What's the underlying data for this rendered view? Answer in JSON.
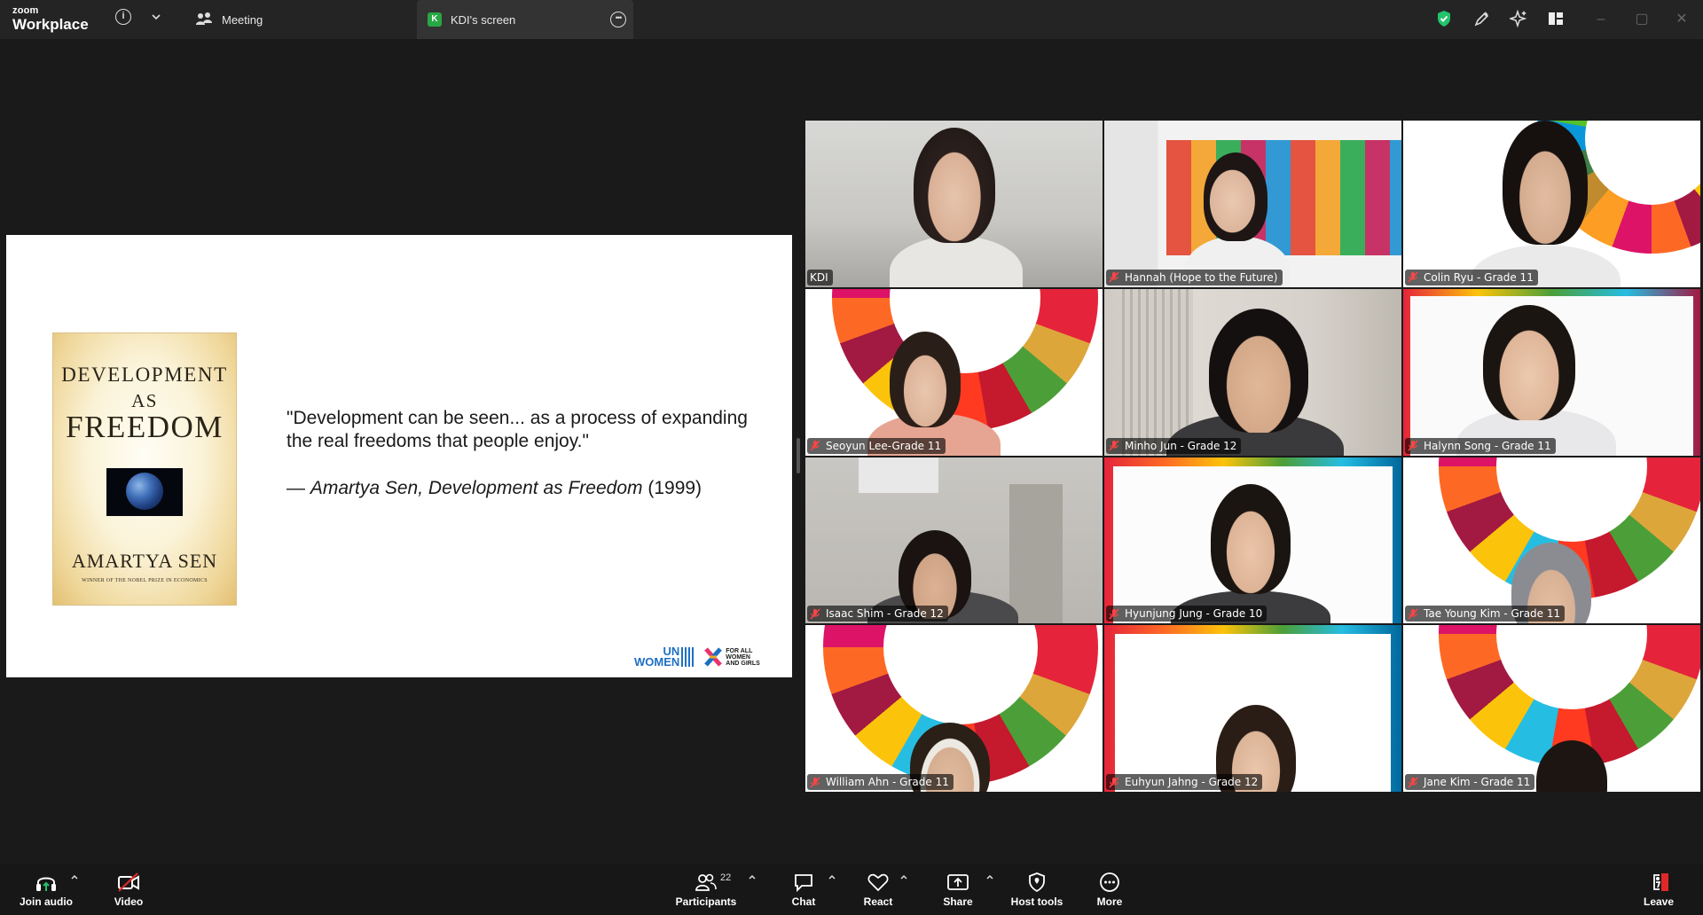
{
  "app": {
    "logo_top": "zoom",
    "logo_bottom": "Workplace"
  },
  "tabs": [
    {
      "label": "Meeting"
    },
    {
      "label": "KDI's screen",
      "badge": "K"
    }
  ],
  "slide": {
    "book": {
      "title_line1": "DEVELOPMENT",
      "title_line2": "AS",
      "title_line3": "FREEDOM",
      "author": "AMARTYA SEN",
      "tagline": "WINNER OF THE NOBEL PRIZE IN ECONOMICS"
    },
    "quote": "\"Development can be seen... as a process of expanding the real freedoms that people enjoy.\"",
    "attribution_prefix": "— ",
    "attribution_italic": "Amartya Sen, Development as Freedom",
    "attribution_year": " (1999)",
    "logo_un_1": "UN",
    "logo_un_2": "WOMEN",
    "logo_forall": [
      "FOR ALL",
      "WOMEN",
      "AND GIRLS"
    ]
  },
  "participants": [
    {
      "name": "KDI",
      "muted": false,
      "active": true
    },
    {
      "name": "Hannah (Hope to the Future)",
      "muted": true
    },
    {
      "name": "Colin Ryu - Grade 11",
      "muted": true
    },
    {
      "name": "Seoyun Lee-Grade 11",
      "muted": true
    },
    {
      "name": "Minho Jun - Grade 12",
      "muted": true
    },
    {
      "name": "Halynn Song - Grade 11",
      "muted": true
    },
    {
      "name": "Isaac Shim - Grade 12",
      "muted": true
    },
    {
      "name": "Hyunjung Jung - Grade 10",
      "muted": true
    },
    {
      "name": "Tae Young Kim - Grade 11",
      "muted": true
    },
    {
      "name": "William Ahn - Grade 11",
      "muted": true
    },
    {
      "name": "Euhyun Jahng - Grade 12",
      "muted": true
    },
    {
      "name": "Jane Kim - Grade 11",
      "muted": true
    }
  ],
  "toolbar": {
    "join_audio": "Join audio",
    "video": "Video",
    "participants": "Participants",
    "participant_count": "22",
    "chat": "Chat",
    "react": "React",
    "share": "Share",
    "host_tools": "Host tools",
    "more": "More",
    "leave": "Leave"
  },
  "colors": {
    "accent_green": "#3ed487",
    "leave_red": "#e02828",
    "background": "#1a1a1a"
  }
}
